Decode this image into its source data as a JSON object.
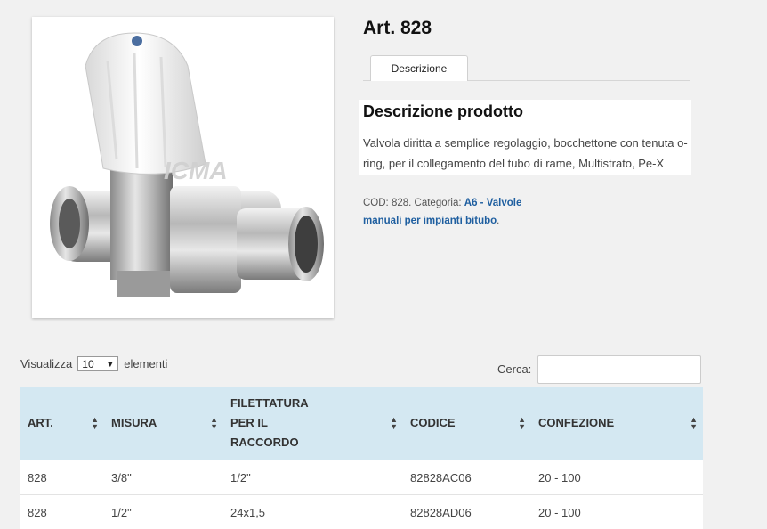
{
  "product": {
    "title": "Art. 828",
    "image_brand_watermark": "ICMA"
  },
  "tabs": [
    {
      "label": "Descrizione",
      "active": true
    }
  ],
  "description": {
    "heading": "Descrizione prodotto",
    "text": "Valvola diritta a semplice regolaggio, bocchettone con tenuta o-ring, per il collegamento del tubo di rame, Multistrato, Pe-X"
  },
  "meta": {
    "cod_text": "COD: 828. Categoria: ",
    "category_link": "A6 - Valvole manuali per impianti bitubo",
    "end": "."
  },
  "table_controls": {
    "show_label": "Visualizza",
    "page_size": "10",
    "elements_label": "elementi",
    "search_label": "Cerca:",
    "search_value": ""
  },
  "table": {
    "headers": [
      "ART.",
      "MISURA",
      "FILETTATURA PER IL RACCORDO",
      "CODICE",
      "CONFEZIONE"
    ],
    "rows": [
      [
        "828",
        "3/8\"",
        "1/2\"",
        "82828AC06",
        "20 - 100"
      ],
      [
        "828",
        "1/2\"",
        "24x1,5",
        "82828AD06",
        "20 - 100"
      ]
    ]
  },
  "colors": {
    "table_header_bg": "#d4e8f2",
    "link": "#1f5fa0",
    "page_bg": "#f1f1f1"
  }
}
